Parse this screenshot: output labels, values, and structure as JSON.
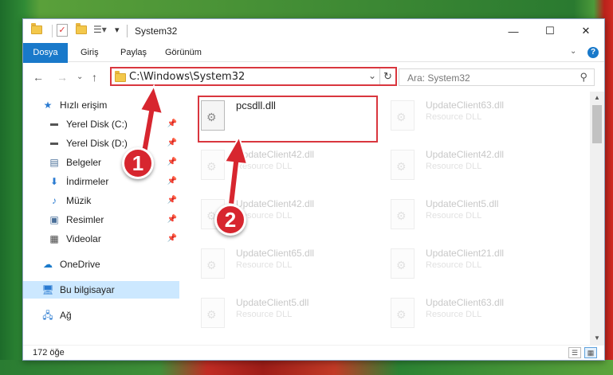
{
  "window": {
    "title": "System32",
    "controls": {
      "minimize": "—",
      "maximize": "☐",
      "close": "✕"
    }
  },
  "ribbon": {
    "tabs": [
      "Dosya",
      "Giriş",
      "Paylaş",
      "Görünüm"
    ],
    "help": "?"
  },
  "address": {
    "path": "C:\\Windows\\System32",
    "search_placeholder": "Ara: System32"
  },
  "sidebar": {
    "items": [
      {
        "label": "Hızlı erişim",
        "icon": "star-icon"
      },
      {
        "label": "Yerel Disk (C:)",
        "icon": "drive-icon",
        "pinned": true
      },
      {
        "label": "Yerel Disk (D:)",
        "icon": "drive-icon",
        "pinned": true
      },
      {
        "label": "Belgeler",
        "icon": "document-icon",
        "pinned": true
      },
      {
        "label": "İndirmeler",
        "icon": "download-icon",
        "pinned": true
      },
      {
        "label": "Müzik",
        "icon": "music-icon",
        "pinned": true
      },
      {
        "label": "Resimler",
        "icon": "pictures-icon",
        "pinned": true
      },
      {
        "label": "Videolar",
        "icon": "video-icon",
        "pinned": true
      },
      {
        "label": "OneDrive",
        "icon": "cloud-icon"
      },
      {
        "label": "Bu bilgisayar",
        "icon": "computer-icon",
        "selected": true
      },
      {
        "label": "Ağ",
        "icon": "network-icon"
      }
    ]
  },
  "files": [
    {
      "name": "pcsdll.dll",
      "type": "",
      "highlight": true
    },
    {
      "name": "UpdateClient63.dll",
      "type": "Resource DLL"
    },
    {
      "name": "UpdateClient42.dll",
      "type": "Resource DLL"
    },
    {
      "name": "UpdateClient42.dll",
      "type": "Resource DLL"
    },
    {
      "name": "UpdateClient42.dll",
      "type": "Resource DLL"
    },
    {
      "name": "UpdateClient5.dll",
      "type": "Resource DLL"
    },
    {
      "name": "UpdateClient65.dll",
      "type": "Resource DLL"
    },
    {
      "name": "UpdateClient21.dll",
      "type": "Resource DLL"
    },
    {
      "name": "UpdateClient5.dll",
      "type": "Resource DLL"
    },
    {
      "name": "UpdateClient63.dll",
      "type": "Resource DLL"
    }
  ],
  "status": {
    "count": "172 öğe"
  },
  "annotations": {
    "step1": "1",
    "step2": "2",
    "color": "#d7262f"
  }
}
